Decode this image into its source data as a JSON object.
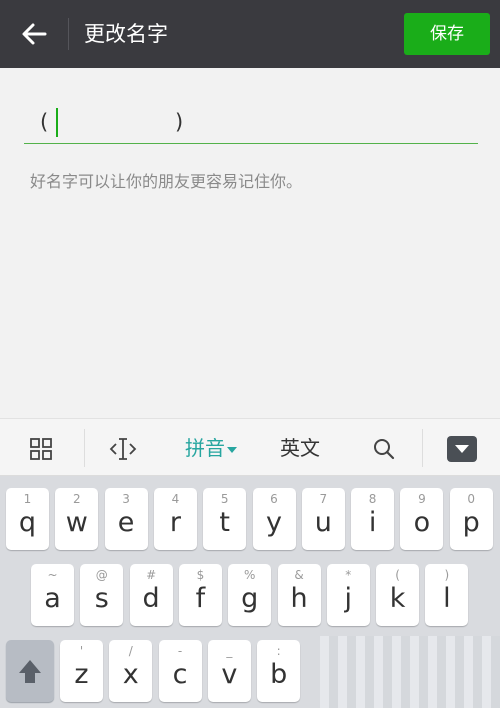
{
  "header": {
    "title": "更改名字",
    "save_label": "保存"
  },
  "form": {
    "name_value": "(                   )",
    "hint": "好名字可以让你的朋友更容易记住你。"
  },
  "keyboard_toolbar": {
    "pinyin_label": "拼音",
    "english_label": "英文"
  },
  "keyboard": {
    "row1": [
      {
        "hint": "1",
        "char": "q"
      },
      {
        "hint": "2",
        "char": "w"
      },
      {
        "hint": "3",
        "char": "e"
      },
      {
        "hint": "4",
        "char": "r"
      },
      {
        "hint": "5",
        "char": "t"
      },
      {
        "hint": "6",
        "char": "y"
      },
      {
        "hint": "7",
        "char": "u"
      },
      {
        "hint": "8",
        "char": "i"
      },
      {
        "hint": "9",
        "char": "o"
      },
      {
        "hint": "0",
        "char": "p"
      }
    ],
    "row2": [
      {
        "hint": "~",
        "char": "a"
      },
      {
        "hint": "@",
        "char": "s"
      },
      {
        "hint": "#",
        "char": "d"
      },
      {
        "hint": "$",
        "char": "f"
      },
      {
        "hint": "%",
        "char": "g"
      },
      {
        "hint": "&",
        "char": "h"
      },
      {
        "hint": "*",
        "char": "j"
      },
      {
        "hint": "(",
        "char": "k"
      },
      {
        "hint": ")",
        "char": "l"
      }
    ],
    "row3": [
      {
        "hint": "'",
        "char": "z"
      },
      {
        "hint": "/",
        "char": "x"
      },
      {
        "hint": "-",
        "char": "c"
      },
      {
        "hint": "_",
        "char": "v"
      },
      {
        "hint": ":",
        "char": "b"
      }
    ]
  },
  "colors": {
    "header_bg": "#3a3a3f",
    "save_button": "#1aad19",
    "input_underline": "#53b24a",
    "active_toolbar": "#27a6a0"
  }
}
